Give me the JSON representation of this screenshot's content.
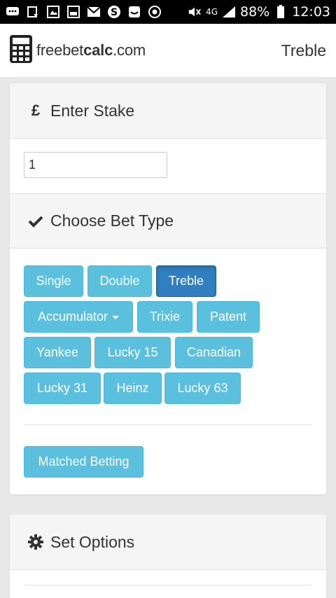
{
  "statusbar": {
    "network": "4G",
    "battery": "88%",
    "time": "12:03",
    "icons": [
      "message-icon",
      "download-icon",
      "image-icon",
      "gallery-icon",
      "mail-icon",
      "skype-icon",
      "inbox-icon",
      "target-icon",
      "mute-icon",
      "signal-icon",
      "battery-icon"
    ]
  },
  "header": {
    "brand_prefix": "freebet",
    "brand_bold": "calc",
    "brand_suffix": ".com",
    "page_title": "Treble"
  },
  "stake": {
    "heading": "Enter Stake",
    "currency_icon": "£",
    "value": "1"
  },
  "bet_type": {
    "heading": "Choose Bet Type",
    "selected": "Treble",
    "buttons": {
      "single": "Single",
      "double": "Double",
      "treble": "Treble",
      "accumulator": "Accumulator",
      "trixie": "Trixie",
      "patent": "Patent",
      "yankee": "Yankee",
      "lucky15": "Lucky 15",
      "canadian": "Canadian",
      "lucky31": "Lucky 31",
      "heinz": "Heinz",
      "lucky63": "Lucky 63"
    },
    "matched_betting": "Matched Betting"
  },
  "options": {
    "heading": "Set Options"
  },
  "colors": {
    "button": "#5bc0de",
    "button_active": "#2f7fc1",
    "panel_header": "#f5f5f5",
    "background": "#e8e8e8"
  }
}
